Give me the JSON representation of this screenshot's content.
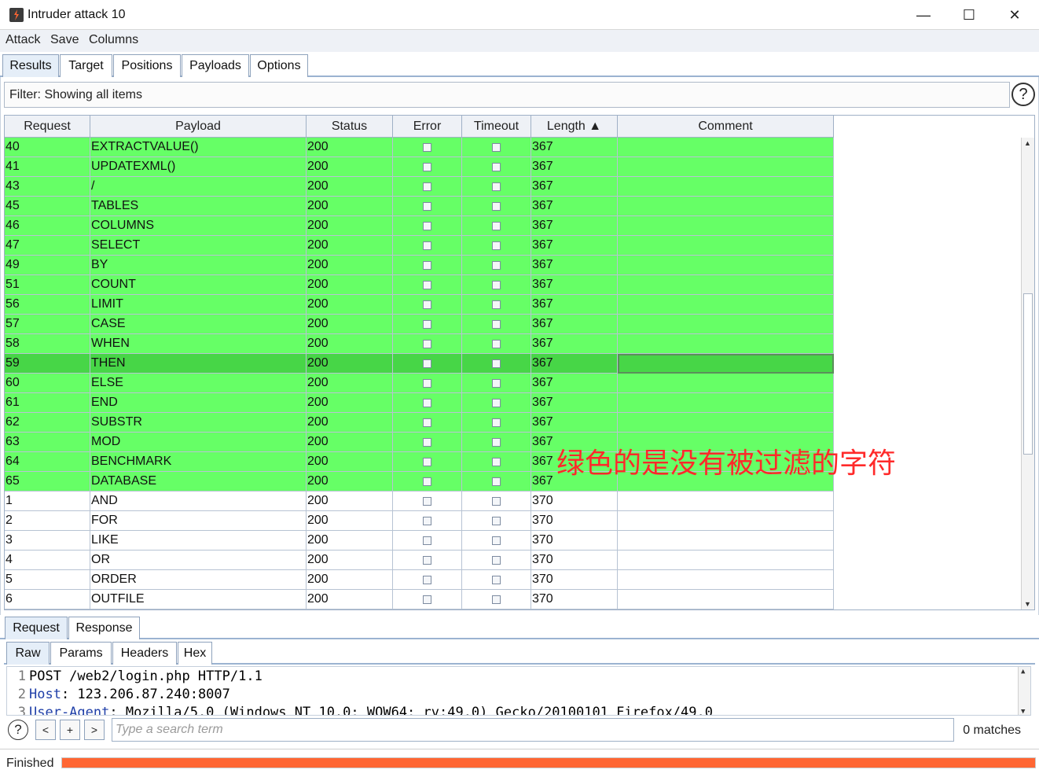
{
  "window": {
    "title": "Intruder attack 10",
    "minimize": "—",
    "maximize": "☐",
    "close": "✕"
  },
  "menu": [
    "Attack",
    "Save",
    "Columns"
  ],
  "main_tabs": [
    "Results",
    "Target",
    "Positions",
    "Payloads",
    "Options"
  ],
  "filter": {
    "text": "Filter: Showing all items",
    "help": "?"
  },
  "table": {
    "columns": [
      "Request",
      "Payload",
      "Status",
      "Error",
      "Timeout",
      "Length ▲",
      "Comment"
    ],
    "rows": [
      {
        "request": "40",
        "payload": "EXTRACTVALUE()",
        "status": "200",
        "length": "367",
        "comment": "",
        "green": true
      },
      {
        "request": "41",
        "payload": "UPDATEXML()",
        "status": "200",
        "length": "367",
        "comment": "",
        "green": true
      },
      {
        "request": "43",
        "payload": "/",
        "status": "200",
        "length": "367",
        "comment": "",
        "green": true
      },
      {
        "request": "45",
        "payload": "TABLES",
        "status": "200",
        "length": "367",
        "comment": "",
        "green": true
      },
      {
        "request": "46",
        "payload": "COLUMNS",
        "status": "200",
        "length": "367",
        "comment": "",
        "green": true
      },
      {
        "request": "47",
        "payload": "SELECT",
        "status": "200",
        "length": "367",
        "comment": "",
        "green": true
      },
      {
        "request": "49",
        "payload": "BY",
        "status": "200",
        "length": "367",
        "comment": "",
        "green": true
      },
      {
        "request": "51",
        "payload": "COUNT",
        "status": "200",
        "length": "367",
        "comment": "",
        "green": true
      },
      {
        "request": "56",
        "payload": "LIMIT",
        "status": "200",
        "length": "367",
        "comment": "",
        "green": true
      },
      {
        "request": "57",
        "payload": "CASE",
        "status": "200",
        "length": "367",
        "comment": "",
        "green": true
      },
      {
        "request": "58",
        "payload": "WHEN",
        "status": "200",
        "length": "367",
        "comment": "",
        "green": true
      },
      {
        "request": "59",
        "payload": "THEN",
        "status": "200",
        "length": "367",
        "comment": "",
        "green": true,
        "selected": true
      },
      {
        "request": "60",
        "payload": "ELSE",
        "status": "200",
        "length": "367",
        "comment": "",
        "green": true
      },
      {
        "request": "61",
        "payload": "END",
        "status": "200",
        "length": "367",
        "comment": "",
        "green": true
      },
      {
        "request": "62",
        "payload": "SUBSTR",
        "status": "200",
        "length": "367",
        "comment": "",
        "green": true
      },
      {
        "request": "63",
        "payload": "MOD",
        "status": "200",
        "length": "367",
        "comment": "",
        "green": true
      },
      {
        "request": "64",
        "payload": "BENCHMARK",
        "status": "200",
        "length": "367",
        "comment": "",
        "green": true
      },
      {
        "request": "65",
        "payload": "DATABASE",
        "status": "200",
        "length": "367",
        "comment": "",
        "green": true
      },
      {
        "request": "1",
        "payload": "AND",
        "status": "200",
        "length": "370",
        "comment": "",
        "green": false
      },
      {
        "request": "2",
        "payload": "FOR",
        "status": "200",
        "length": "370",
        "comment": "",
        "green": false
      },
      {
        "request": "3",
        "payload": "LIKE",
        "status": "200",
        "length": "370",
        "comment": "",
        "green": false
      },
      {
        "request": "4",
        "payload": "OR",
        "status": "200",
        "length": "370",
        "comment": "",
        "green": false
      },
      {
        "request": "5",
        "payload": "ORDER",
        "status": "200",
        "length": "370",
        "comment": "",
        "green": false
      },
      {
        "request": "6",
        "payload": "OUTFILE",
        "status": "200",
        "length": "370",
        "comment": "",
        "green": false
      }
    ]
  },
  "annotation": "绿色的是没有被过滤的字符",
  "lower_tabs": [
    "Request",
    "Response"
  ],
  "sub_tabs": [
    "Raw",
    "Params",
    "Headers",
    "Hex"
  ],
  "editor_lines": [
    {
      "num": "1",
      "key": "",
      "rest": "POST /web2/login.php HTTP/1.1"
    },
    {
      "num": "2",
      "key": "Host",
      "rest": ": 123.206.87.240:8007"
    },
    {
      "num": "3",
      "key": "User-Agent",
      "rest": ": Mozilla/5.0 (Windows NT 10.0; WOW64; rv:49.0) Gecko/20100101 Firefox/49.0"
    }
  ],
  "search": {
    "help": "?",
    "prev": "<",
    "add": "+",
    "next": ">",
    "placeholder": "Type a search term",
    "matches": "0 matches"
  },
  "status": {
    "text": "Finished",
    "progress": 1.0
  },
  "colors": {
    "row_green": "#66ff66",
    "row_selected": "#47d647",
    "progress": "#ff6633",
    "annotation": "#ff2a2a"
  }
}
